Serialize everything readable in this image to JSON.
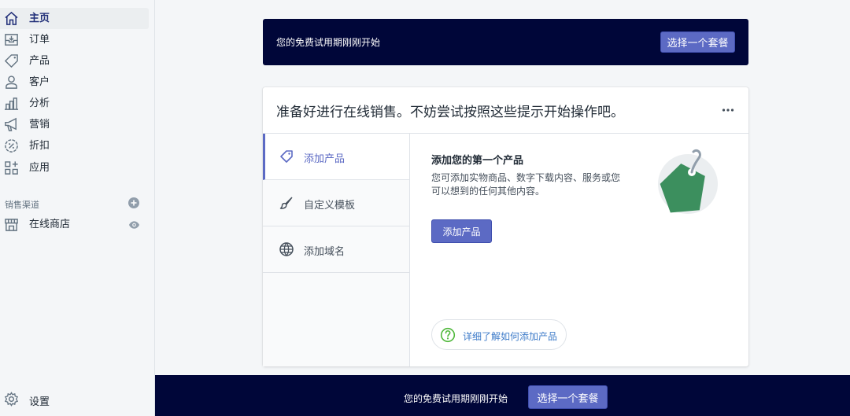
{
  "sidebar": {
    "items": [
      {
        "label": "主页",
        "icon": "home-icon",
        "active": true
      },
      {
        "label": "订单",
        "icon": "orders-icon"
      },
      {
        "label": "产品",
        "icon": "tag-icon"
      },
      {
        "label": "客户",
        "icon": "person-icon"
      },
      {
        "label": "分析",
        "icon": "bar-chart-icon"
      },
      {
        "label": "营销",
        "icon": "megaphone-icon"
      },
      {
        "label": "折扣",
        "icon": "discount-icon"
      },
      {
        "label": "应用",
        "icon": "apps-icon"
      }
    ],
    "sales_channels_title": "销售渠道",
    "channel": {
      "label": "在线商店",
      "icon": "store-icon"
    },
    "settings_label": "设置"
  },
  "top_banner": {
    "text": "您的免费试用期刚刚开始",
    "button": "选择一个套餐"
  },
  "card": {
    "title": "准备好进行在线销售。不妨尝试按照这些提示开始操作吧。",
    "tabs": [
      {
        "label": "添加产品",
        "icon": "tag-icon",
        "active": true
      },
      {
        "label": "自定义模板",
        "icon": "brush-icon"
      },
      {
        "label": "添加域名",
        "icon": "globe-icon"
      }
    ],
    "panel": {
      "title": "添加您的第一个产品",
      "description": "您可添加实物商品、数字下载内容、服务或您可以想到的任何其他内容。",
      "button": "添加产品",
      "help_link": "详细了解如何添加产品"
    }
  },
  "bottom_banner": {
    "text": "您的免费试用期刚刚开始",
    "button": "选择一个套餐"
  },
  "colors": {
    "accent": "#5c6ac4",
    "banner": "#000639",
    "tag_green": "#3c8f5e"
  }
}
